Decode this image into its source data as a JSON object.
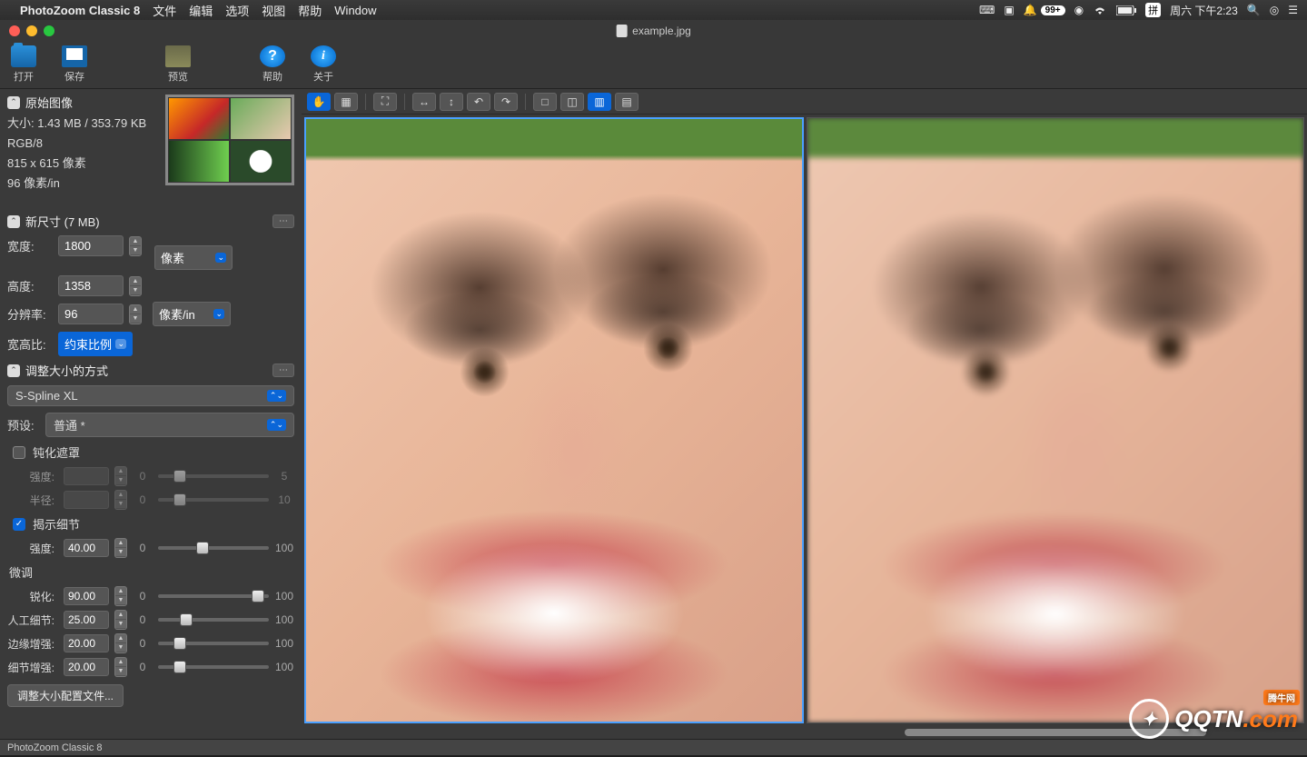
{
  "menubar": {
    "app": "PhotoZoom Classic 8",
    "items": [
      "文件",
      "编辑",
      "选项",
      "视图",
      "帮助",
      "Window"
    ],
    "right": {
      "notif": "99+",
      "lang": "拼",
      "datetime": "周六 下午2:23"
    }
  },
  "titlebar": {
    "filename": "example.jpg"
  },
  "toolbar": {
    "open": "打开",
    "save": "保存",
    "preview": "预览",
    "help": "帮助",
    "about": "关于"
  },
  "original": {
    "header": "原始图像",
    "size": "大小: 1.43 MB / 353.79 KB",
    "mode": "RGB/8",
    "dims": "815 x 615 像素",
    "dpi": "96 像素/in"
  },
  "newsize": {
    "header": "新尺寸 (7 MB)",
    "width_label": "宽度:",
    "width": "1800",
    "height_label": "高度:",
    "height": "1358",
    "unit": "像素",
    "res_label": "分辨率:",
    "res": "96",
    "res_unit": "像素/in",
    "aspect_label": "宽高比:",
    "aspect": "约束比例"
  },
  "resize_method": {
    "header": "调整大小的方式",
    "method": "S-Spline XL",
    "preset_label": "预设:",
    "preset": "普通 *",
    "unsharp": {
      "label": "钝化遮罩",
      "checked": false,
      "intensity_label": "强度:",
      "intensity": "",
      "min": "0",
      "max": "5",
      "radius_label": "半径:",
      "radius": "",
      "rmin": "0",
      "rmax": "10"
    },
    "reveal": {
      "label": "揭示细节",
      "checked": true,
      "intensity_label": "强度:",
      "intensity": "40.00",
      "min": "0",
      "max": "100",
      "pct": 40
    },
    "fine_label": "微调",
    "sliders": [
      {
        "label": "锐化:",
        "value": "90.00",
        "min": "0",
        "max": "100",
        "pct": 90
      },
      {
        "label": "人工细节:",
        "value": "25.00",
        "min": "0",
        "max": "100",
        "pct": 25
      },
      {
        "label": "边缘增强:",
        "value": "20.00",
        "min": "0",
        "max": "100",
        "pct": 20
      },
      {
        "label": "细节增强:",
        "value": "20.00",
        "min": "0",
        "max": "100",
        "pct": 20
      }
    ],
    "cfg_button": "调整大小配置文件..."
  },
  "statusbar": {
    "text": "PhotoZoom Classic 8"
  },
  "watermark": {
    "brand": "QQTN",
    "suffix": ".com",
    "tag": "腾牛网"
  }
}
